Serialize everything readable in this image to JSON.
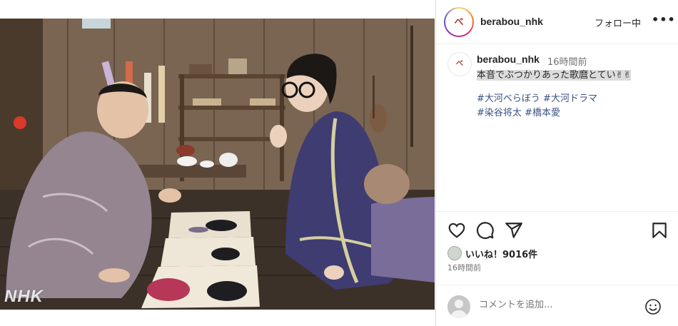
{
  "photo": {
    "watermark": "NHK"
  },
  "header": {
    "username": "berabou_nhk",
    "follow_label": "フォロー中",
    "more_label": "•••",
    "avatar_text": "べ"
  },
  "caption": {
    "username": "berabou_nhk",
    "time": "16時間前",
    "text": "本音でぶつかりあった歌麿とてい✌✌",
    "hashtags": [
      "#大河べらぼう",
      "#大河ドラマ",
      "#染谷将太",
      "#橋本愛"
    ]
  },
  "actions": {
    "icons": [
      "heart-icon",
      "comment-icon",
      "share-icon",
      "bookmark-icon"
    ]
  },
  "likes": {
    "text": "いいね！9016件"
  },
  "post_time": "16時間前",
  "comment": {
    "placeholder": "コメントを追加..."
  },
  "colors": {
    "hashtag": "#385185",
    "muted": "#737373",
    "border": "#dbdbdb"
  }
}
